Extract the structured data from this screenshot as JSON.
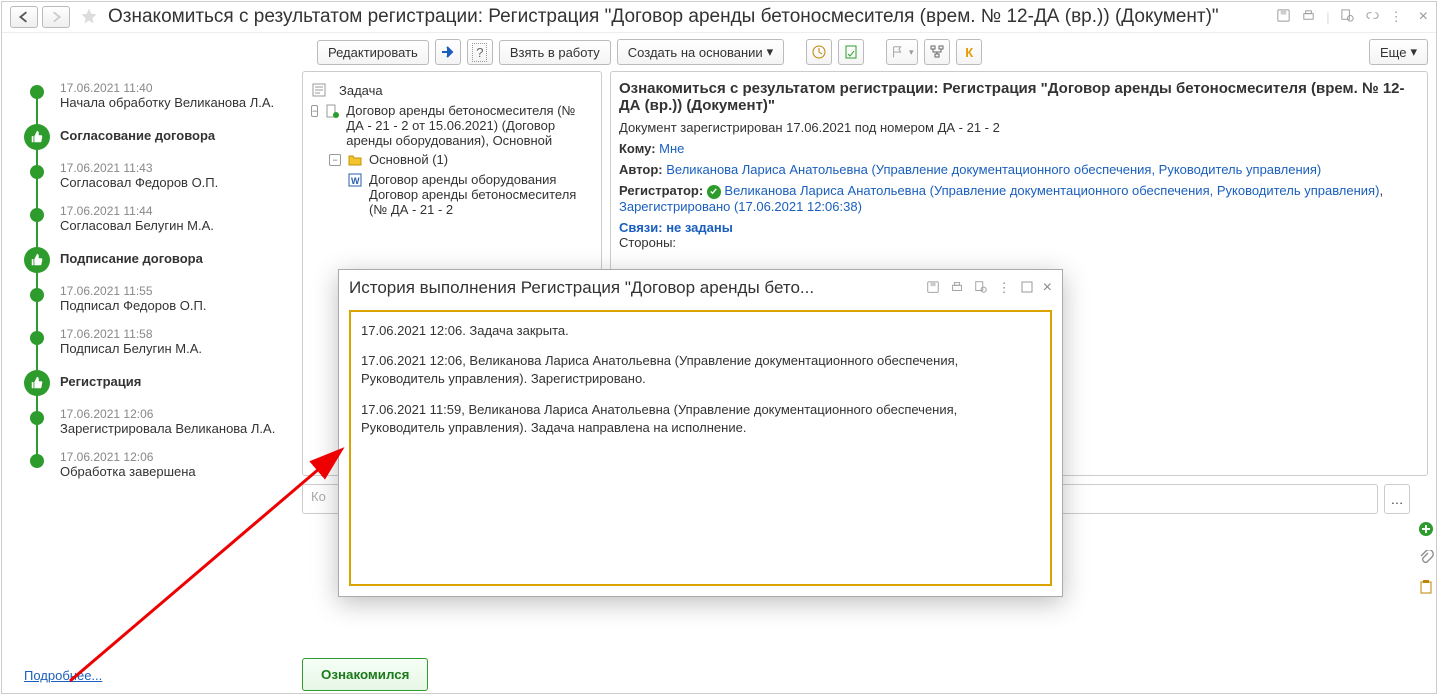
{
  "title": "Ознакомиться с результатом регистрации: Регистрация \"Договор аренды бетоносмесителя (врем. № 12-ДА (вр.)) (Документ)\"",
  "toolbar": {
    "edit": "Редактировать",
    "take": "Взять в работу",
    "create": "Создать на основании",
    "more": "Еще"
  },
  "timeline": {
    "items": [
      {
        "date": "17.06.2021 11:40",
        "text": "Начала обработку Великанова Л.А.",
        "type": "dot"
      },
      {
        "text": "Согласование договора",
        "type": "big"
      },
      {
        "date": "17.06.2021 11:43",
        "text": "Согласовал Федоров О.П.",
        "type": "dot"
      },
      {
        "date": "17.06.2021 11:44",
        "text": "Согласовал Белугин М.А.",
        "type": "dot"
      },
      {
        "text": "Подписание договора",
        "type": "big"
      },
      {
        "date": "17.06.2021 11:55",
        "text": "Подписал Федоров О.П.",
        "type": "dot"
      },
      {
        "date": "17.06.2021 11:58",
        "text": "Подписал Белугин М.А.",
        "type": "dot"
      },
      {
        "text": "Регистрация",
        "type": "big"
      },
      {
        "date": "17.06.2021 12:06",
        "text": "Зарегистрировала Великанова Л.А.",
        "type": "dot"
      },
      {
        "date": "17.06.2021 12:06",
        "text": "Обработка завершена",
        "type": "dot"
      }
    ],
    "more": "Подробнее..."
  },
  "tree": {
    "task": "Задача",
    "doc": "Договор аренды бетоносмесителя (№ ДА - 21 - 2 от 15.06.2021) (Договор аренды оборудования), Основной",
    "folder": "Основной (1)",
    "file": "Договор аренды оборудования Договор аренды бетоносмесителя (№ ДА - 21 - 2"
  },
  "detail": {
    "title": "Ознакомиться с результатом регистрации: Регистрация \"Договор аренды бетоносмесителя (врем. № 12-ДА (вр.)) (Документ)\"",
    "sub": "Документ зарегистрирован 17.06.2021 под номером ДА - 21 - 2",
    "to_label": "Кому:",
    "to_value": "Мне",
    "author_label": "Автор:",
    "author_value": "Великанова Лариса Анатольевна (Управление документационного обеспечения, Руководитель управления)",
    "reg_label": "Регистратор:",
    "reg_value": "Великанова Лариса Анатольевна (Управление документационного обеспечения, Руководитель управления)",
    "reg_status": "Зарегистрировано (17.06.2021 12:06:38)",
    "links_label": "Связи: не заданы",
    "sides": "Стороны:"
  },
  "popup": {
    "title": "История выполнения Регистрация \"Договор аренды бето...",
    "p1": "17.06.2021 12:06. Задача закрыта.",
    "p2": "17.06.2021 12:06, Великанова Лариса Анатольевна (Управление документационного обеспечения, Руководитель управления). Зарегистрировано.",
    "p3": "17.06.2021 11:59, Великанова Лариса Анатольевна (Управление документационного обеспечения, Руководитель управления). Задача направлена на исполнение."
  },
  "comment_placeholder": "Ко",
  "ok_button": "Ознакомился"
}
